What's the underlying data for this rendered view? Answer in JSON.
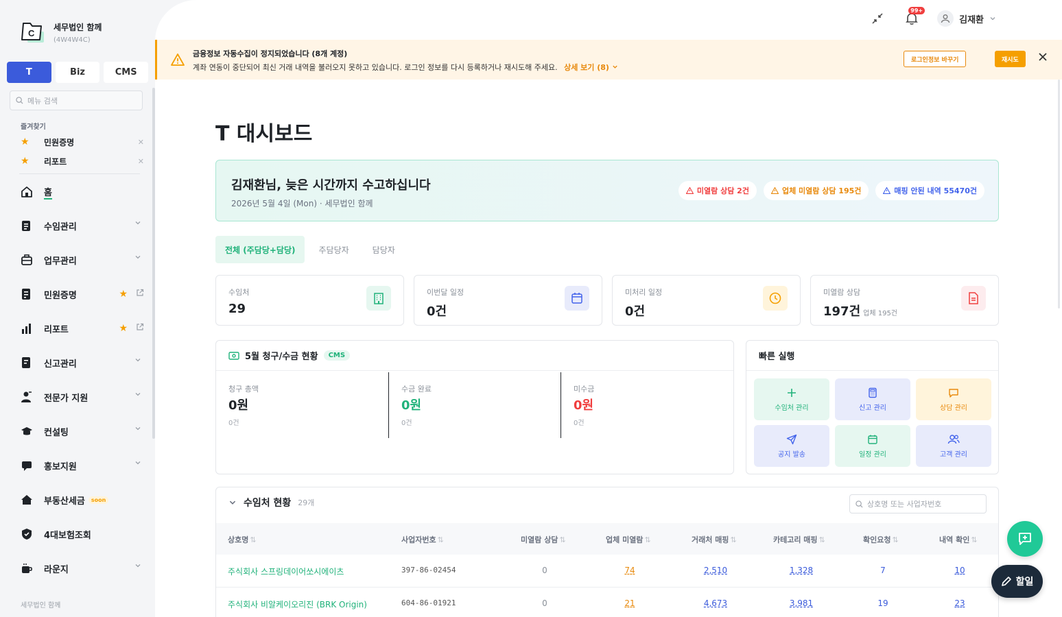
{
  "brand": {
    "name": "세무법인 함께",
    "code": "(4W4W4C)"
  },
  "mode_tabs": [
    "T",
    "Biz",
    "CMS"
  ],
  "menu_search": {
    "placeholder": "메뉴 검색"
  },
  "favorites": {
    "title": "즐겨찾기",
    "items": [
      "민원증명",
      "리포트"
    ]
  },
  "nav": [
    {
      "label": "홈",
      "icon": "home-icon"
    },
    {
      "label": "수임관리",
      "icon": "clipboard-icon"
    },
    {
      "label": "업무관리",
      "icon": "briefcase-icon"
    },
    {
      "label": "민원증명",
      "icon": "document-icon"
    },
    {
      "label": "리포트",
      "icon": "chart-icon"
    },
    {
      "label": "신고관리",
      "icon": "form-icon"
    },
    {
      "label": "전문가 지원",
      "icon": "expert-icon"
    },
    {
      "label": "컨설팅",
      "icon": "graduation-icon"
    },
    {
      "label": "홍보지원",
      "icon": "megaphone-icon"
    },
    {
      "label": "부동산세금",
      "icon": "house-icon",
      "tag": "soon"
    },
    {
      "label": "4대보험조회",
      "icon": "shield-icon"
    },
    {
      "label": "라운지",
      "icon": "coffee-icon"
    }
  ],
  "sidebar_footer": "세무법인 함께",
  "topbar": {
    "notification_badge": "99+",
    "user_name": "김재환"
  },
  "alert": {
    "title": "금융정보 자동수집이 정지되었습니다 (8개 계정)",
    "message": "계좌 연동이 중단되어 최신 거래 내역을 불러오지 못하고 있습니다. 로그인 정보를 다시 등록하거나 재시도해 주세요.",
    "link": "상세 보기 (8)",
    "btn_change": "로그인정보 바꾸기",
    "btn_retry": "재시도"
  },
  "page_title": "T 대시보드",
  "welcome": {
    "title": "김재환님, 늦은 시간까지 수고하십니다",
    "subtitle": "2026년 5월 4일 (Mon) · 세무법인 함께",
    "pills": [
      "미열람 상담 2건",
      "업체 미열람 상담 195건",
      "매핑 안된 내역 55470건"
    ]
  },
  "scope_tabs": [
    "전체 (주담당+담당)",
    "주담당자",
    "담당자"
  ],
  "stats": [
    {
      "label": "수임처",
      "value": "29",
      "sub": ""
    },
    {
      "label": "이번달 일정",
      "value": "0건",
      "sub": ""
    },
    {
      "label": "미처리 일정",
      "value": "0건",
      "sub": ""
    },
    {
      "label": "미열람 상담",
      "value": "197건",
      "sub": "업체 195건"
    }
  ],
  "billing": {
    "title": "5월 청구/수금 현황",
    "tag": "CMS",
    "cols": [
      {
        "label": "청구 총액",
        "value": "0원",
        "count": "0건"
      },
      {
        "label": "수금 완료",
        "value": "0원",
        "count": "0건"
      },
      {
        "label": "미수금",
        "value": "0원",
        "count": "0건"
      }
    ]
  },
  "quick": {
    "title": "빠른 실행",
    "items": [
      "수임처 관리",
      "신고 관리",
      "상담 관리",
      "공지 발송",
      "일정 관리",
      "고객 관리"
    ]
  },
  "clients": {
    "title": "수임처 현황",
    "count": "29개",
    "search_placeholder": "상호명 또는 사업자번호",
    "headers": [
      "상호명",
      "사업자번호",
      "미열람 상담",
      "업체 미열람",
      "거래처 매핑",
      "카테고리 매핑",
      "확인요청",
      "내역 확인"
    ],
    "rows": [
      [
        "주식회사 스프링데이어쏘시에이츠",
        "397-86-02454",
        "0",
        "74",
        "2,510",
        "1,328",
        "7",
        "10"
      ],
      [
        "주식회사 비알케이오리진 (BRK Origin)",
        "604-86-01921",
        "0",
        "21",
        "4,673",
        "3,981",
        "19",
        "23"
      ]
    ]
  },
  "fab_todo": "할일",
  "colors": {
    "brand_blue": "#3b5bdb",
    "accent_green": "#20b27a",
    "warning_orange": "#f59f00",
    "danger_red": "#f03e3e"
  }
}
